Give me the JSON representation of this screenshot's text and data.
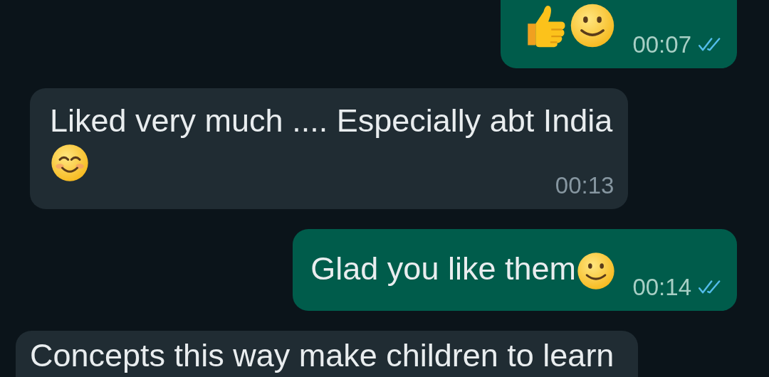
{
  "messages": [
    {
      "kind": "outgoing",
      "time": "00:07",
      "read": true
    },
    {
      "kind": "incoming",
      "text": "Liked very much .... Especially abt India",
      "time": "00:13"
    },
    {
      "kind": "outgoing",
      "text": "Glad you like them",
      "time": "00:14",
      "read": true
    },
    {
      "kind": "incoming",
      "text": "Concepts this way make children to learn"
    }
  ]
}
